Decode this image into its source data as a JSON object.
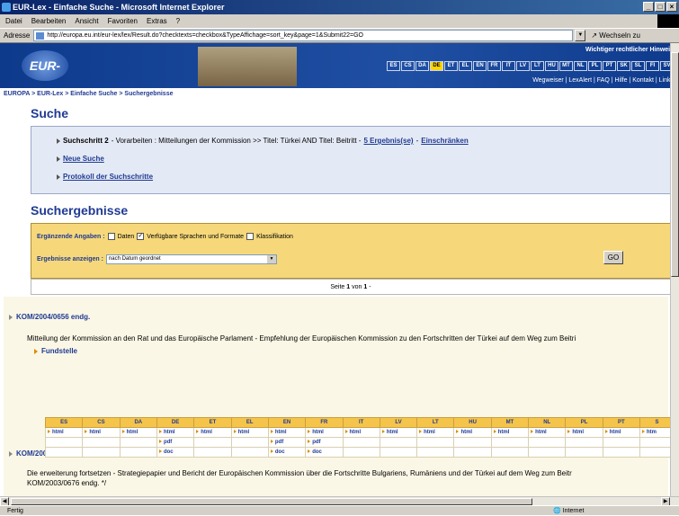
{
  "window": {
    "title": "EUR-Lex - Einfache Suche - Microsoft Internet Explorer",
    "controls": [
      "_",
      "□",
      "×"
    ]
  },
  "menu": [
    "Datei",
    "Bearbeiten",
    "Ansicht",
    "Favoriten",
    "Extras",
    "?"
  ],
  "address": {
    "label": "Adresse",
    "url": "http://europa.eu.int/eur-lex/lex/Result.do?checktexts=checkbox&TypeAffichage=sort_key&page=1&Submit22=GO",
    "go": "Wechseln zu"
  },
  "banner": {
    "logo": "EUR-Lex",
    "hint": "Wichtiger rechtlicher Hinweis",
    "languages": [
      "ES",
      "CS",
      "DA",
      "DE",
      "ET",
      "EL",
      "EN",
      "FR",
      "IT",
      "LV",
      "LT",
      "HU",
      "MT",
      "NL",
      "PL",
      "PT",
      "SK",
      "SL",
      "FI",
      "SV"
    ],
    "selected_language": "DE",
    "links": "Wegweiser | LexAlert | FAQ | Hilfe | Kontakt | Links"
  },
  "breadcrumb": "EUROPA > EUR-Lex > Einfache Suche > Suchergebnisse",
  "search": {
    "heading": "Suche",
    "step_prefix": "Suchschritt 2",
    "step_text": " - Vorarbeiten : Mitteilungen der Kommission >> Titel: Türkei AND Titel: Beitritt - ",
    "step_results": "5 Ergebnis(se)",
    "step_sep": " - ",
    "step_refine": "Einschränken",
    "new_search": "Neue Suche",
    "protocol": "Protokoll der Suchschritte"
  },
  "results_heading": "Suchergebnisse",
  "filters": {
    "label": "Ergänzende Angaben :",
    "opt_data": "Daten",
    "opt_languages": "Verfügbare Sprachen und Formate",
    "opt_class": "Klassifikation",
    "display_label": "Ergebnisse anzeigen :",
    "display_value": "nach Datum geordnet",
    "go": "GO"
  },
  "pager": {
    "text": "Seite",
    "page": "1",
    "of": "von",
    "total": "1",
    "suffix": "-"
  },
  "results": [
    {
      "id": "KOM/2004/0656 endg.",
      "desc": "Mitteilung der Kommission an den Rat und das Europäische Parlament - Empfehlung der Europäischen Kommission zu den Fortschritten der Türkei auf dem Weg zum Beitri",
      "fundstelle": "Fundstelle"
    },
    {
      "id": "KOM/2003/0676 endg.",
      "desc": "Die erweiterung fortsetzen - Strategiepapier und Bericht der Europäischen Kommission über die Fortschritte Bulgariens, Rumäniens und der Türkei auf dem Weg zum Beitr",
      "desc2": "KOM/2003/0676 endg. */"
    }
  ],
  "lang_table": {
    "headers": [
      "ES",
      "CS",
      "DA",
      "DE",
      "ET",
      "EL",
      "EN",
      "FR",
      "IT",
      "LV",
      "LT",
      "HU",
      "MT",
      "NL",
      "PL",
      "PT",
      "S"
    ],
    "rows": [
      [
        "html",
        "html",
        "html",
        "html",
        "html",
        "html",
        "html",
        "html",
        "html",
        "html",
        "html",
        "html",
        "html",
        "html",
        "html",
        "html",
        "htm"
      ],
      [
        "",
        "",
        "",
        "pdf",
        "",
        "",
        "pdf",
        "pdf",
        "",
        "",
        "",
        "",
        "",
        "",
        "",
        "",
        ""
      ],
      [
        "",
        "",
        "",
        "doc",
        "",
        "",
        "doc",
        "doc",
        "",
        "",
        "",
        "",
        "",
        "",
        "",
        "",
        ""
      ]
    ]
  },
  "status": {
    "left": "Fertig",
    "zone": "Internet"
  }
}
